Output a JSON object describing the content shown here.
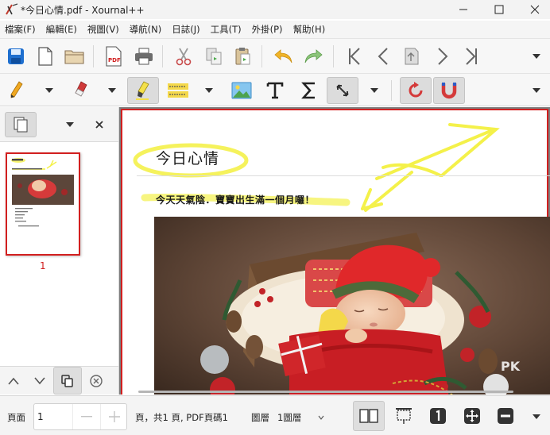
{
  "window": {
    "title": "*今日心情.pdf - Xournal++",
    "app_icon": "xournal-icon",
    "controls": [
      "minimize-icon",
      "maximize-icon",
      "close-icon"
    ]
  },
  "menubar": {
    "items": [
      {
        "label": "檔案(F)"
      },
      {
        "label": "編輯(E)"
      },
      {
        "label": "視圖(V)"
      },
      {
        "label": "導航(N)"
      },
      {
        "label": "日誌(J)"
      },
      {
        "label": "工具(T)"
      },
      {
        "label": "外掛(P)"
      },
      {
        "label": "幫助(H)"
      }
    ]
  },
  "toolbar1": {
    "icons": [
      "save-icon",
      "new-document-icon",
      "open-folder-icon",
      "export-pdf-icon",
      "print-icon",
      "cut-icon",
      "copy-icon",
      "paste-icon",
      "undo-icon",
      "redo-icon",
      "first-page-icon",
      "previous-page-icon",
      "go-to-page-icon",
      "next-page-icon",
      "last-page-icon",
      "toolbar-overflow-icon"
    ],
    "pdf_label": "PDF"
  },
  "toolbar2": {
    "icons": [
      "pen-icon",
      "eraser-icon",
      "highlighter-icon",
      "text-highlight-icon",
      "image-icon",
      "text-tool-icon",
      "math-tex-icon",
      "select-tool-icon",
      "rotation-snapping-icon",
      "grid-snapping-icon",
      "toolbar-overflow-icon"
    ],
    "tex_icon_text": "Σ",
    "text_icon_text": "T"
  },
  "sidebar": {
    "thumbnail_page_number": "1",
    "controls": [
      "page-layers-icon",
      "chevron-down-icon",
      "close-icon"
    ],
    "footer_controls": [
      "move-page-up-icon",
      "move-page-down-icon",
      "copy-page-icon",
      "delete-page-icon"
    ]
  },
  "document": {
    "page_title": "今日心情",
    "subtitle": "今天天氣陰．寶寶出生滿一個月囉！",
    "watermark": "PK"
  },
  "statusbar": {
    "page_label": "頁面",
    "page_value": "1",
    "page_info": "頁，共1 頁, PDF頁碼1",
    "layer_label": "圖層",
    "layer_value": "1圖層",
    "icons": [
      "minus-icon",
      "plus-icon",
      "chevron-down-icon",
      "two-pages-icon",
      "presentation-icon",
      "one-page-icon",
      "fit-page-icon",
      "zoom-out-icon",
      "overflow-icon"
    ]
  },
  "colors": {
    "accent_red": "#d21f1f",
    "highlighter_yellow": "#f4f14a",
    "toolbar_blue": "#1e6fcf"
  }
}
